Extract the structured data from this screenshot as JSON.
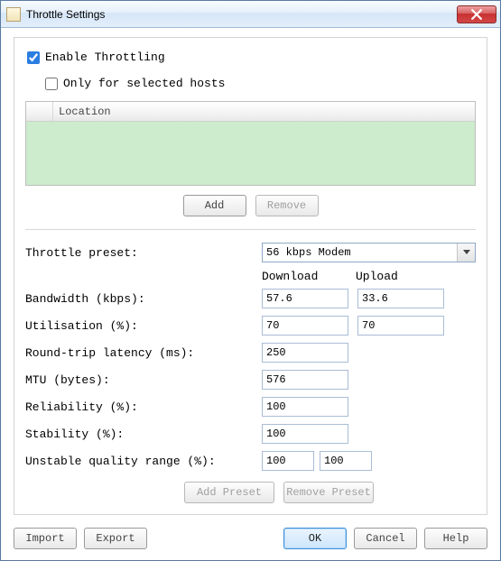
{
  "window": {
    "title": "Throttle Settings"
  },
  "checks": {
    "enable_label": "Enable Throttling",
    "only_hosts_label": "Only for selected hosts"
  },
  "hosts": {
    "col_location": "Location"
  },
  "buttons": {
    "add": "Add",
    "remove": "Remove",
    "add_preset": "Add Preset",
    "remove_preset": "Remove Preset",
    "import_": "Import",
    "export_": "Export",
    "ok": "OK",
    "cancel": "Cancel",
    "help": "Help"
  },
  "form": {
    "preset_label": "Throttle preset:",
    "preset_value": "56 kbps Modem",
    "download_header": "Download",
    "upload_header": "Upload",
    "bandwidth_label": "Bandwidth (kbps):",
    "bandwidth_download": "57.6",
    "bandwidth_upload": "33.6",
    "utilisation_label": "Utilisation (%):",
    "utilisation_download": "70",
    "utilisation_upload": "70",
    "rtt_label": "Round-trip latency (ms):",
    "rtt_value": "250",
    "mtu_label": "MTU (bytes):",
    "mtu_value": "576",
    "reliability_label": "Reliability (%):",
    "reliability_value": "100",
    "stability_label": "Stability (%):",
    "stability_value": "100",
    "unstable_label": "Unstable quality range (%):",
    "unstable_low": "100",
    "unstable_high": "100"
  }
}
